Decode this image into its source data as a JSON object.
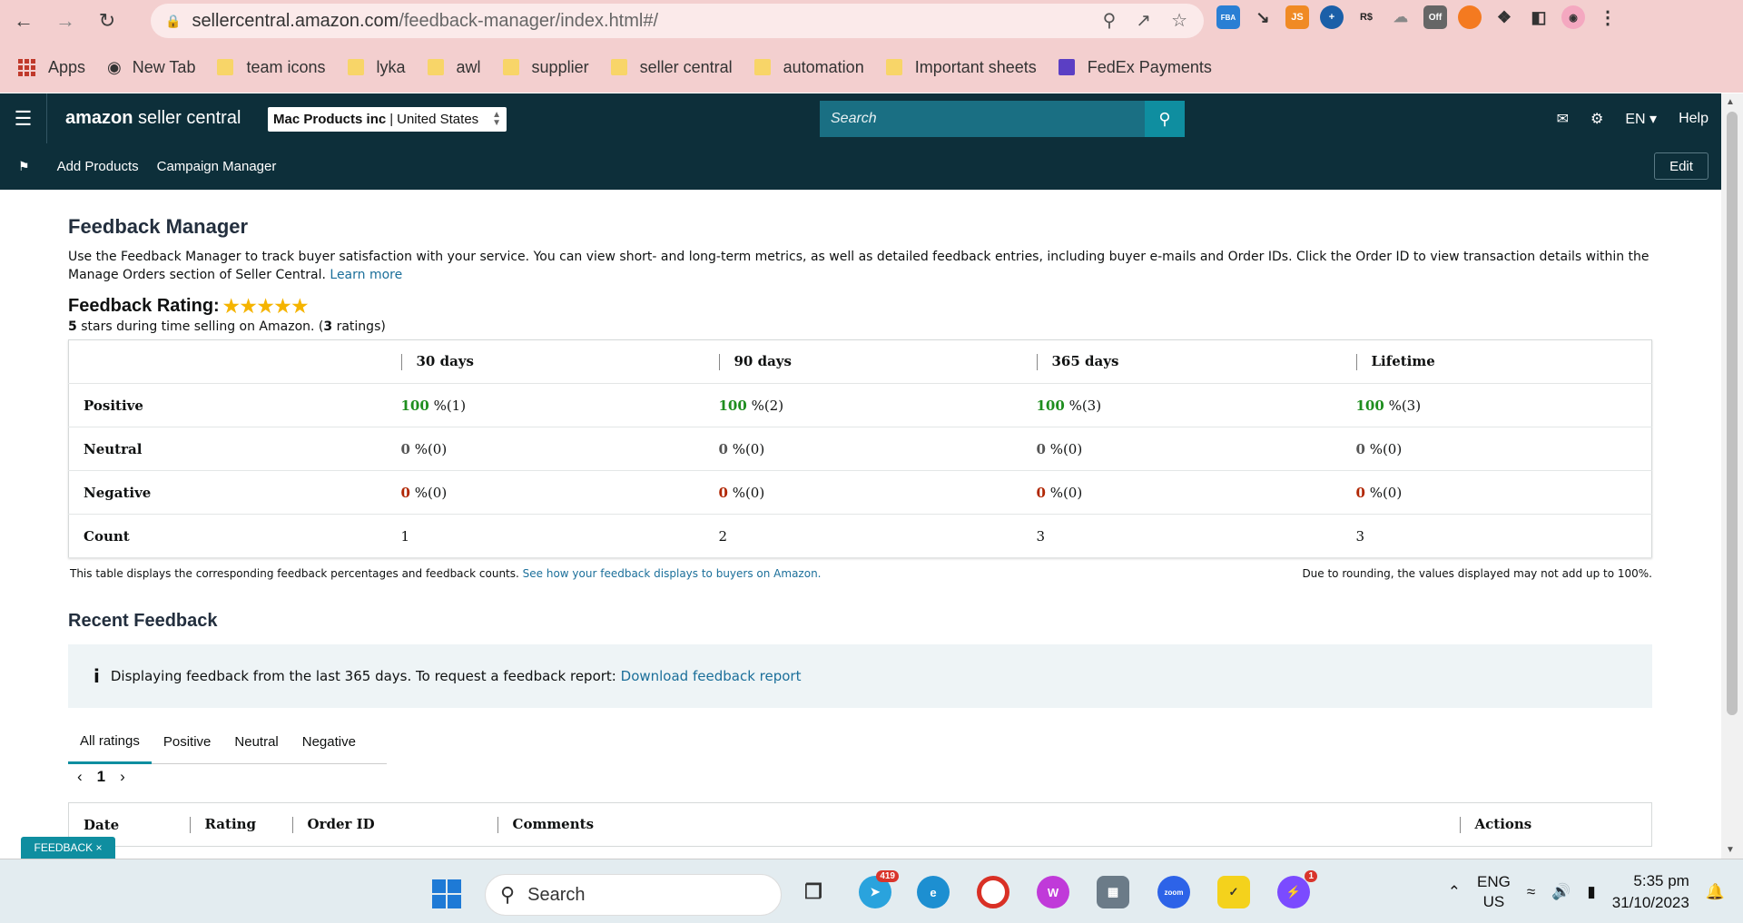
{
  "browser": {
    "url_main": "sellercentral.amazon.com",
    "url_path": "/feedback-manager/index.html#/",
    "bookmarks": [
      "Apps",
      "New Tab",
      "team icons",
      "lyka",
      "awl",
      "supplier",
      "seller central",
      "automation",
      "Important sheets",
      "FedEx Payments"
    ],
    "ext_off_label": "Off"
  },
  "header": {
    "logo_a": "amazon",
    "logo_b": " seller central",
    "account": "Mac Products inc",
    "marketplace": "United States",
    "search_placeholder": "Search",
    "lang": "EN",
    "help": "Help",
    "shortcuts": [
      "Add Products",
      "Campaign Manager"
    ],
    "edit": "Edit"
  },
  "page": {
    "title": "Feedback Manager",
    "description": "Use the Feedback Manager to track buyer satisfaction with your service. You can view short- and long-term metrics, as well as detailed feedback entries, including buyer e-mails and Order IDs. Click the Order ID to view transaction details within the Manage Orders section of Seller Central.",
    "learn_more": "Learn more",
    "rating_label": "Feedback Rating:",
    "stars": "★★★★★",
    "rating_stars_value": 5,
    "rating_desc_a": "5",
    "rating_desc_b": " stars during time selling on Amazon. (",
    "rating_desc_c": "3",
    "rating_desc_d": " ratings)",
    "table": {
      "headers": [
        "30 days",
        "90 days",
        "365 days",
        "Lifetime"
      ],
      "rows": [
        {
          "label": "Positive",
          "cells": [
            [
              "100",
              " %(1)"
            ],
            [
              "100",
              " %(2)"
            ],
            [
              "100",
              " %(3)"
            ],
            [
              "100",
              " %(3)"
            ]
          ]
        },
        {
          "label": "Neutral",
          "cells": [
            [
              "0",
              " %(0)"
            ],
            [
              "0",
              " %(0)"
            ],
            [
              "0",
              " %(0)"
            ],
            [
              "0",
              " %(0)"
            ]
          ]
        },
        {
          "label": "Negative",
          "cells": [
            [
              "0",
              " %(0)"
            ],
            [
              "0",
              " %(0)"
            ],
            [
              "0",
              " %(0)"
            ],
            [
              "0",
              " %(0)"
            ]
          ]
        },
        {
          "label": "Count",
          "cells": [
            [
              "",
              "1"
            ],
            [
              "",
              "2"
            ],
            [
              "",
              "3"
            ],
            [
              "",
              "3"
            ]
          ]
        }
      ]
    },
    "note_left": "This table displays the corresponding feedback percentages and feedback counts.",
    "note_link": "See how your feedback displays to buyers on Amazon.",
    "note_right": "Due to rounding, the values displayed may not add up to 100%.",
    "recent_title": "Recent Feedback",
    "info_text": "Displaying feedback from the last 365 days. To request a feedback report:",
    "info_link": "Download feedback report",
    "tabs": [
      "All ratings",
      "Positive",
      "Neutral",
      "Negative"
    ],
    "page_num": "1",
    "recent_headers": [
      "Date",
      "Rating",
      "Order ID",
      "Comments",
      "Actions"
    ],
    "feedback_tab": "FEEDBACK ×"
  },
  "taskbar": {
    "search": "Search",
    "telegram_badge": "419",
    "messenger_badge": "1",
    "lang_a": "ENG",
    "lang_b": "US",
    "time": "5:35 pm",
    "date": "31/10/2023"
  }
}
